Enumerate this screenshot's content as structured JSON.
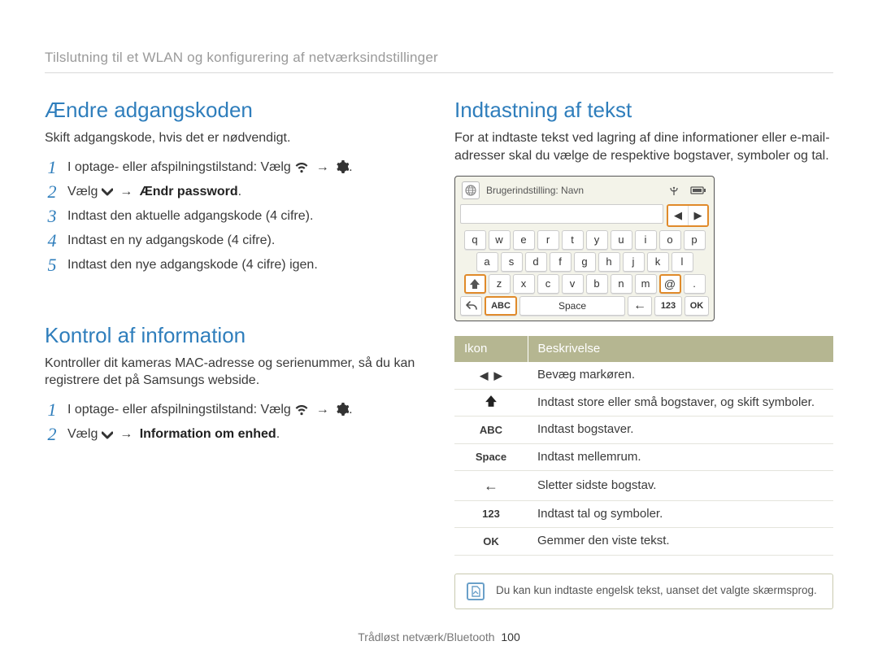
{
  "breadcrumb": "Tilslutning til et WLAN og konfigurering af netværksindstillinger",
  "left": {
    "s1": {
      "title": "Ændre adgangskoden",
      "intro": "Skift adgangskode, hvis det er nødvendigt.",
      "step1_prefix": "I optage- eller afspilningstilstand: Vælg ",
      "arrow": "→",
      "dot": ".",
      "step2_prefix": "Vælg ",
      "step2_bold": "Ændr password",
      "step3": "Indtast den aktuelle adgangskode (4 cifre).",
      "step4": "Indtast en ny adgangskode (4 cifre).",
      "step5": "Indtast den nye adgangskode (4 cifre) igen."
    },
    "s2": {
      "title": "Kontrol af information",
      "intro": "Kontroller dit kameras MAC-adresse og serienummer, så du kan registrere det på Samsungs webside.",
      "step1_prefix": "I optage- eller afspilningstilstand: Vælg ",
      "arrow": "→",
      "dot": ".",
      "step2_prefix": "Vælg ",
      "step2_bold": "Information om enhed"
    }
  },
  "right": {
    "title": "Indtastning af tekst",
    "intro": "For at indtaste tekst ved lagring af dine informationer eller e-mail-adresser skal du vælge de respektive bogstaver, symboler og tal.",
    "kbd": {
      "top_label": "Brugerindstilling: Navn",
      "row1": [
        "q",
        "w",
        "e",
        "r",
        "t",
        "y",
        "u",
        "i",
        "o",
        "p"
      ],
      "row2": [
        "a",
        "s",
        "d",
        "f",
        "g",
        "h",
        "j",
        "k",
        "l"
      ],
      "row3": [
        "z",
        "x",
        "c",
        "v",
        "b",
        "n",
        "m",
        "@",
        "."
      ],
      "abc": "ABC",
      "space": "Space",
      "num": "123",
      "ok": "OK"
    },
    "table": {
      "h_icon": "Ikon",
      "h_desc": "Beskrivelse",
      "rows": [
        {
          "icon": "◀  ▶",
          "desc": "Bevæg markøren."
        },
        {
          "icon": "shift",
          "desc": "Indtast store eller små bogstaver, og skift symboler."
        },
        {
          "icon": "ABC",
          "desc": "Indtast bogstaver."
        },
        {
          "icon": "Space",
          "desc": "Indtast mellemrum."
        },
        {
          "icon": "←",
          "desc": "Sletter sidste bogstav."
        },
        {
          "icon": "123",
          "desc": "Indtast tal og symboler."
        },
        {
          "icon": "OK",
          "desc": "Gemmer den viste tekst."
        }
      ]
    },
    "note": "Du kan kun indtaste engelsk tekst, uanset det valgte skærmsprog."
  },
  "footer": {
    "section": "Trådløst netværk/Bluetooth",
    "page": "100"
  }
}
